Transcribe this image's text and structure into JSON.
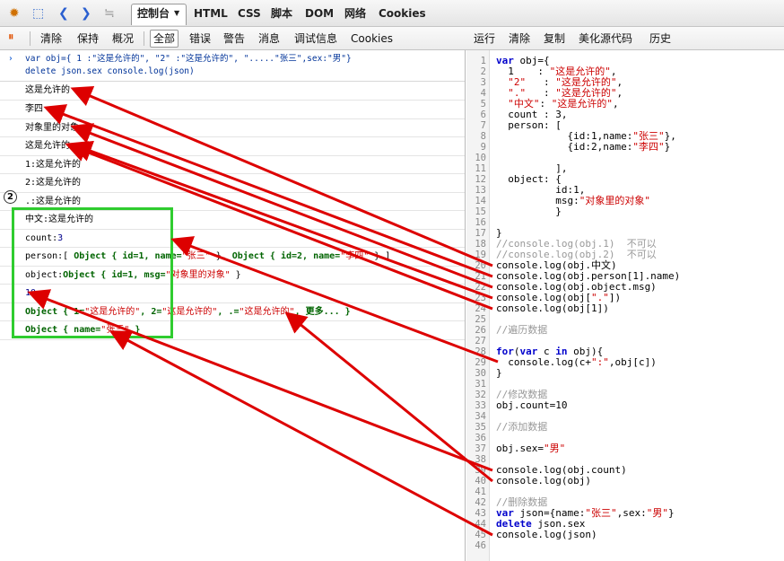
{
  "toolbar": {
    "tabs": [
      "控制台",
      "HTML",
      "CSS",
      "脚本",
      "DOM",
      "网络",
      "Cookies"
    ],
    "active_tab": "控制台"
  },
  "console_toolbar": {
    "items": [
      "清除",
      "保持",
      "概况",
      "全部",
      "错误",
      "警告",
      "消息",
      "调试信息",
      "Cookies"
    ],
    "selected": "全部"
  },
  "editor_toolbar": {
    "items": [
      "运行",
      "清除",
      "复制",
      "美化源代码",
      "历史"
    ]
  },
  "console": {
    "command_line1": "var obj={      1     :\"这是允许的\",    \"2\"   :\"这是允许的\",   \".....\"张三\",sex:\"男\"}",
    "command_line2": "delete json.sex console.log(json)",
    "badge": "2",
    "rows": [
      {
        "kind": "text",
        "text": "这是允许的"
      },
      {
        "kind": "text",
        "text": "李四"
      },
      {
        "kind": "text",
        "text": "对象里的对象"
      },
      {
        "kind": "text",
        "text": "这是允许的"
      },
      {
        "kind": "text",
        "text": "1:这是允许的"
      },
      {
        "kind": "text",
        "text": "2:这是允许的"
      },
      {
        "kind": "text",
        "text": ".:这是允许的"
      },
      {
        "kind": "text",
        "text": "中文:这是允许的"
      },
      {
        "kind": "count",
        "label": "count:",
        "value": "3"
      },
      {
        "kind": "person",
        "label": "person:",
        "p1": "[ ",
        "o1": "Object { id=1,  name=",
        "s1": "\"张三\"",
        "p2": " }, ",
        "o2": "Object { id=2,  name=",
        "s2": "\"李四\"",
        "p3": " } ]"
      },
      {
        "kind": "object",
        "label": "object:",
        "o1": "Object { id=1,  msg=",
        "s1": "\"对象里的对象\"",
        "p1": " }"
      },
      {
        "kind": "num",
        "text": "10"
      },
      {
        "kind": "obj3",
        "o1": "Object { 1=",
        "s1": "\"这是允许的\"",
        "o2": ",  2=",
        "s2": "\"这是允许的\"",
        "o3": ",  .=",
        "s3": "\"这是允许的\"",
        "o4": ",  更多... }"
      },
      {
        "kind": "obj4",
        "o1": "Object { name=",
        "s1": "\"张三\"",
        "o2": " }"
      }
    ]
  },
  "editor": {
    "lines": [
      "var obj={",
      "  1    : \"这是允许的\",",
      "  \"2\"   : \"这是允许的\",",
      "  \".\"   : \"这是允许的\",",
      "  \"中文\": \"这是允许的\",",
      "  count : 3,",
      "  person: [",
      "            {id:1,name:\"张三\"},",
      "            {id:2,name:\"李四\"}",
      "",
      "          ],",
      "  object: {",
      "          id:1,",
      "          msg:\"对象里的对象\"",
      "          }",
      "",
      "}",
      "//console.log(obj.1)  不可以",
      "//console.log(obj.2)  不可以",
      "console.log(obj.中文)",
      "console.log(obj.person[1].name)",
      "console.log(obj.object.msg)",
      "console.log(obj[\".\"])",
      "console.log(obj[1])",
      "",
      "//遍历数据",
      "",
      "for(var c in obj){",
      "  console.log(c+\":\",obj[c])",
      "}",
      "",
      "//修改数据",
      "obj.count=10",
      "",
      "//添加数据",
      "",
      "obj.sex=\"男\"",
      "",
      "console.log(obj.count)",
      "console.log(obj)",
      "",
      "//删除数据",
      "var json={name:\"张三\",sex:\"男\"}",
      "delete json.sex",
      "console.log(json)",
      ""
    ]
  },
  "colors": {
    "arrow": "#dd0000",
    "highlight_box": "#2fcc2f"
  }
}
